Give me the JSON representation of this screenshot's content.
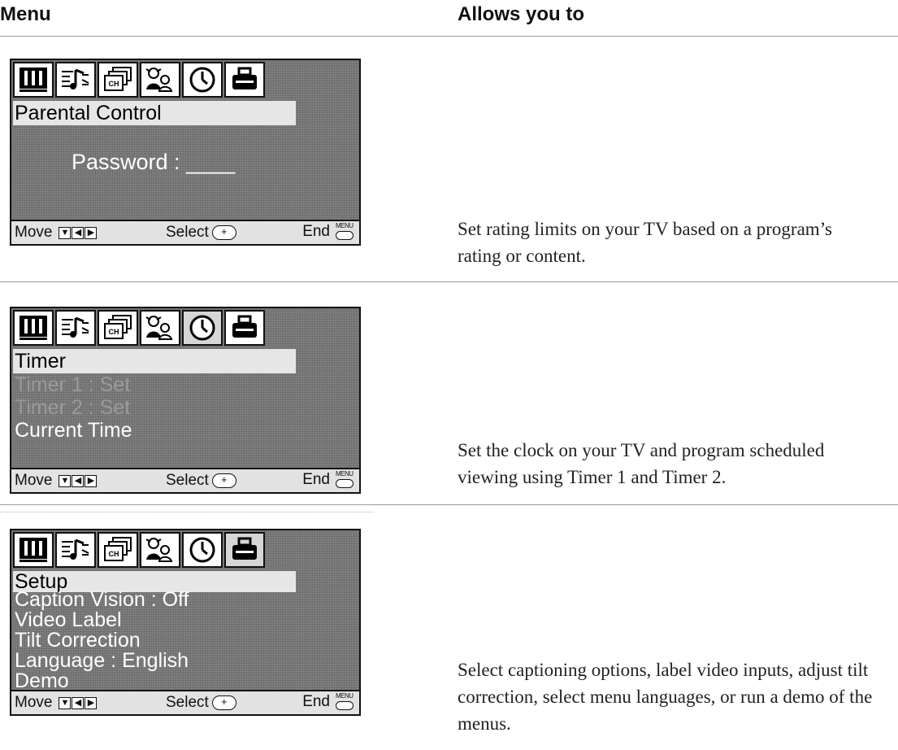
{
  "header": {
    "menu": "Menu",
    "allows": "Allows you to"
  },
  "menu_icons": [
    "picture-icon",
    "sound-icon",
    "channel-icon",
    "parental-icon",
    "clock-icon",
    "setup-icon"
  ],
  "footer": {
    "move": "Move",
    "select": "Select",
    "end": "End",
    "menu_key": "MENU"
  },
  "rows": [
    {
      "title": "Parental Control",
      "selected_icon": 3,
      "password_label": "Password : ____",
      "description": "Set rating limits on your TV based on a program’s rating or content."
    },
    {
      "title": "Timer",
      "selected_icon": 4,
      "items": [
        {
          "label": "Timer 1 : Set",
          "dim": true
        },
        {
          "label": "Timer 2 : Set",
          "dim": true
        },
        {
          "label": "Current  Time",
          "dim": false
        }
      ],
      "description": "Set the clock on your TV and program scheduled viewing using Timer 1 and Timer 2."
    },
    {
      "title": "Setup",
      "selected_icon": 5,
      "items": [
        {
          "label": "Caption Vision : Off"
        },
        {
          "label": "Video Label"
        },
        {
          "label": "Tilt Correction"
        },
        {
          "label": "Language : English"
        },
        {
          "label": "Demo"
        }
      ],
      "description": "Select captioning options, label video inputs, adjust tilt correction, select menu languages, or run a demo of the menus."
    }
  ]
}
